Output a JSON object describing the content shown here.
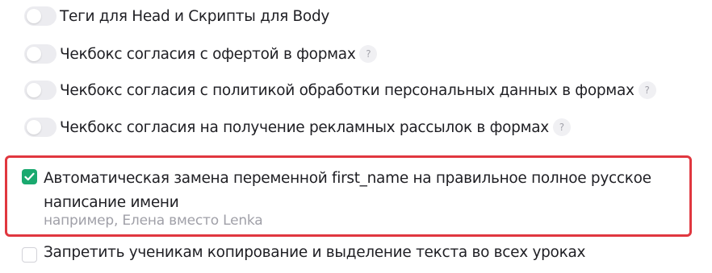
{
  "settings": {
    "toggles": [
      {
        "label": "Теги для Head и Скрипты для Body",
        "enabled": false,
        "has_help": false
      },
      {
        "label": "Чекбокс согласия с офертой в формах",
        "enabled": false,
        "has_help": true
      },
      {
        "label": "Чекбокс согласия с политикой обработки персональных данных в формах",
        "enabled": false,
        "has_help": true
      },
      {
        "label": "Чекбокс согласия на получение рекламных рассылок в формах",
        "enabled": false,
        "has_help": true
      }
    ],
    "help_glyph": "?",
    "auto_name": {
      "label": "Автоматическая замена переменной first_name на правильное полное русское написание имени",
      "hint": "например, Елена вместо Lenka",
      "checked": true,
      "highlight_color": "#e0373f"
    },
    "copy_protect": {
      "label": "Запретить ученикам копирование и выделение текста во всех уроках",
      "checked": false
    }
  },
  "colors": {
    "checkbox_checked": "#1aa96f",
    "toggle_off_track": "#ececf0",
    "text": "#1f1f24",
    "hint_text": "#a0a0a8"
  }
}
